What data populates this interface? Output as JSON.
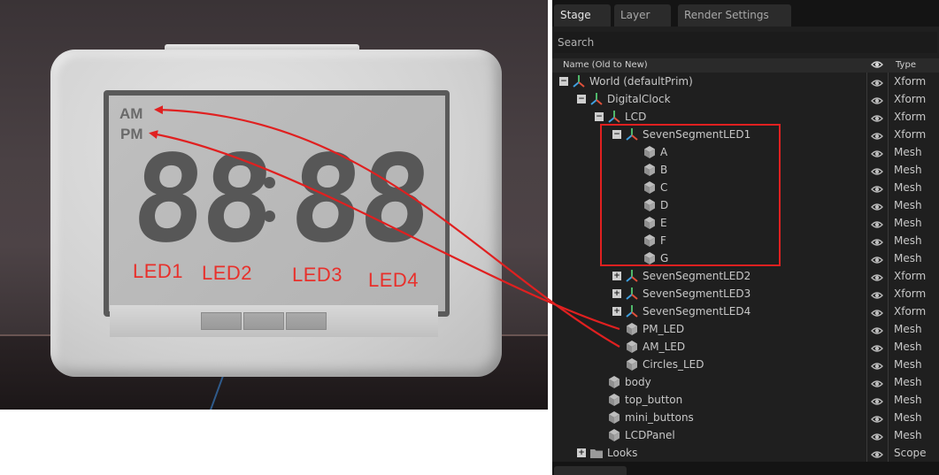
{
  "viewport": {
    "lcd": {
      "am": "AM",
      "pm": "PM",
      "digits_left": "88",
      "digits_right": "88"
    },
    "led_labels": [
      "LED1",
      "LED2",
      "LED3",
      "LED4"
    ],
    "annotation_color": "#e8302b"
  },
  "stage": {
    "tabs": [
      {
        "label": "Stage",
        "active": true
      },
      {
        "label": "Layer",
        "active": false
      },
      {
        "label": "Render Settings",
        "active": false
      }
    ],
    "search_placeholder": "Search",
    "columns": {
      "name": "Name (Old to New)",
      "visibility_icon": "eye-icon",
      "type": "Type"
    },
    "rows": [
      {
        "label": "World (defaultPrim)",
        "type": "Xform",
        "icon": "xform-axes-icon",
        "expander": "minus",
        "depth": 0
      },
      {
        "label": "DigitalClock",
        "type": "Xform",
        "icon": "xform-axes-icon",
        "expander": "minus",
        "depth": 1
      },
      {
        "label": "LCD",
        "type": "Xform",
        "icon": "xform-axes-icon",
        "expander": "minus",
        "depth": 2
      },
      {
        "label": "SevenSegmentLED1",
        "type": "Xform",
        "icon": "xform-axes-icon",
        "expander": "minus",
        "depth": 3
      },
      {
        "label": "A",
        "type": "Mesh",
        "icon": "mesh-cube-icon",
        "expander": "none",
        "depth": 4
      },
      {
        "label": "B",
        "type": "Mesh",
        "icon": "mesh-cube-icon",
        "expander": "none",
        "depth": 4
      },
      {
        "label": "C",
        "type": "Mesh",
        "icon": "mesh-cube-icon",
        "expander": "none",
        "depth": 4
      },
      {
        "label": "D",
        "type": "Mesh",
        "icon": "mesh-cube-icon",
        "expander": "none",
        "depth": 4
      },
      {
        "label": "E",
        "type": "Mesh",
        "icon": "mesh-cube-icon",
        "expander": "none",
        "depth": 4
      },
      {
        "label": "F",
        "type": "Mesh",
        "icon": "mesh-cube-icon",
        "expander": "none",
        "depth": 4
      },
      {
        "label": "G",
        "type": "Mesh",
        "icon": "mesh-cube-icon",
        "expander": "none",
        "depth": 4
      },
      {
        "label": "SevenSegmentLED2",
        "type": "Xform",
        "icon": "xform-axes-icon",
        "expander": "plus",
        "depth": 3
      },
      {
        "label": "SevenSegmentLED3",
        "type": "Xform",
        "icon": "xform-axes-icon",
        "expander": "plus",
        "depth": 3
      },
      {
        "label": "SevenSegmentLED4",
        "type": "Xform",
        "icon": "xform-axes-icon",
        "expander": "plus",
        "depth": 3
      },
      {
        "label": "PM_LED",
        "type": "Mesh",
        "icon": "mesh-cube-icon",
        "expander": "none",
        "depth": 3
      },
      {
        "label": "AM_LED",
        "type": "Mesh",
        "icon": "mesh-cube-icon",
        "expander": "none",
        "depth": 3
      },
      {
        "label": "Circles_LED",
        "type": "Mesh",
        "icon": "mesh-cube-icon",
        "expander": "none",
        "depth": 3
      },
      {
        "label": "body",
        "type": "Mesh",
        "icon": "mesh-cube-icon",
        "expander": "none",
        "depth": 2
      },
      {
        "label": "top_button",
        "type": "Mesh",
        "icon": "mesh-cube-icon",
        "expander": "none",
        "depth": 2
      },
      {
        "label": "mini_buttons",
        "type": "Mesh",
        "icon": "mesh-cube-icon",
        "expander": "none",
        "depth": 2
      },
      {
        "label": "LCDPanel",
        "type": "Mesh",
        "icon": "mesh-cube-icon",
        "expander": "none",
        "depth": 2
      },
      {
        "label": "Looks",
        "type": "Scope",
        "icon": "folder-icon",
        "expander": "plus",
        "depth": 1
      }
    ]
  }
}
